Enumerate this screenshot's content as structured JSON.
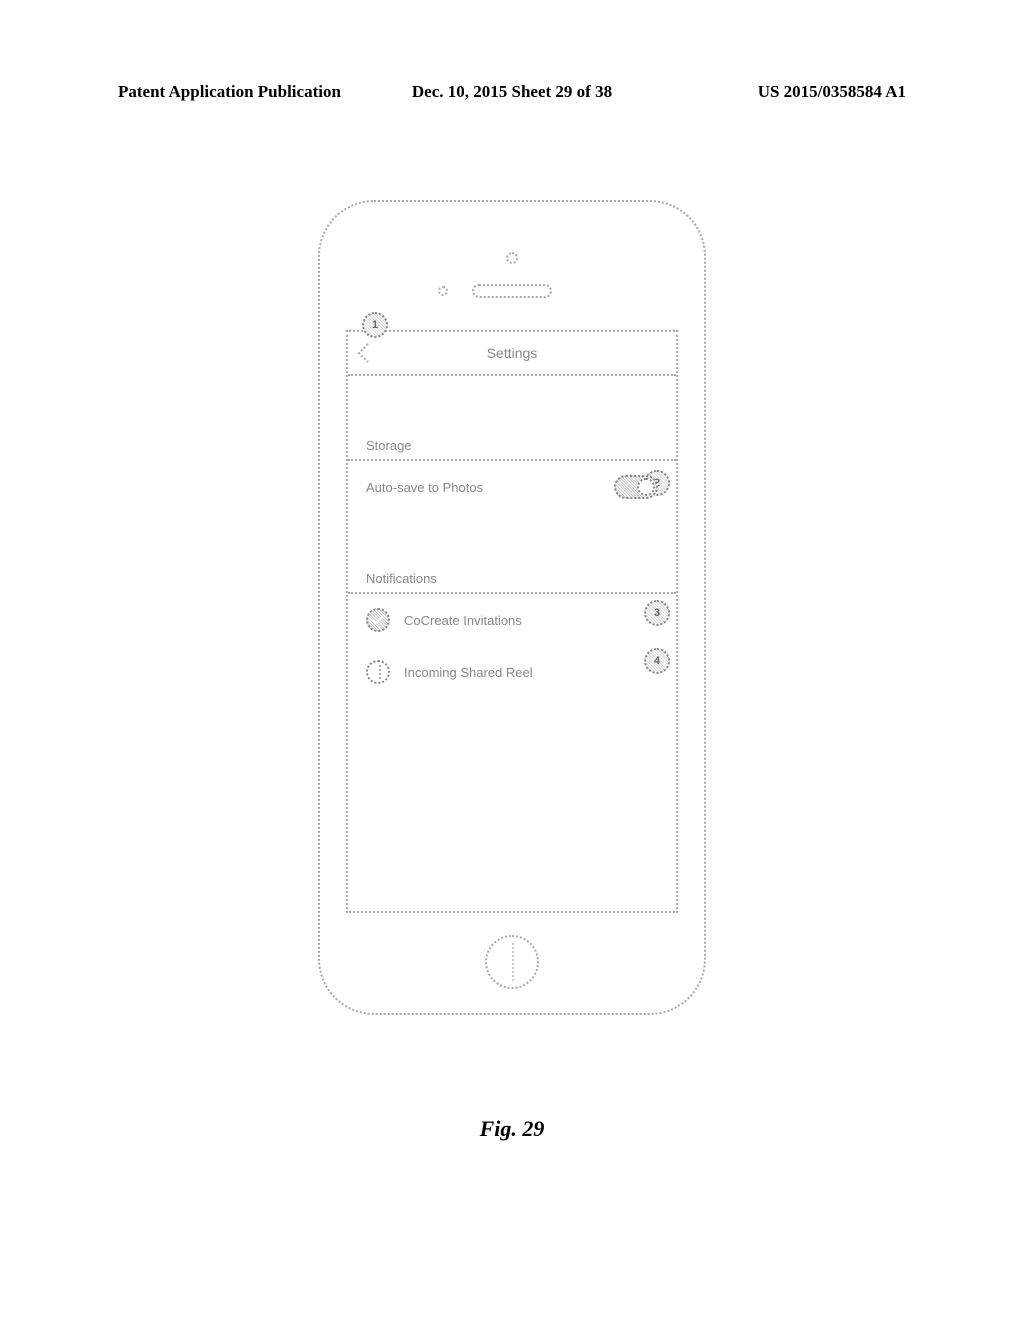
{
  "header": {
    "left": "Patent Application Publication",
    "center": "Dec. 10, 2015  Sheet 29 of 38",
    "right": "US 2015/0358584 A1"
  },
  "screen": {
    "title": "Settings",
    "sections": {
      "storage": {
        "header": "Storage",
        "auto_save_label": "Auto-save to Photos",
        "auto_save_on": true
      },
      "notifications": {
        "header": "Notifications",
        "items": [
          {
            "label": "CoCreate Invitations",
            "checked": true
          },
          {
            "label": "Incoming Shared Reel",
            "checked": false
          }
        ]
      }
    }
  },
  "callouts": {
    "c1": "1",
    "c2": "2",
    "c3": "3",
    "c4": "4"
  },
  "figure_label": "Fig. 29"
}
